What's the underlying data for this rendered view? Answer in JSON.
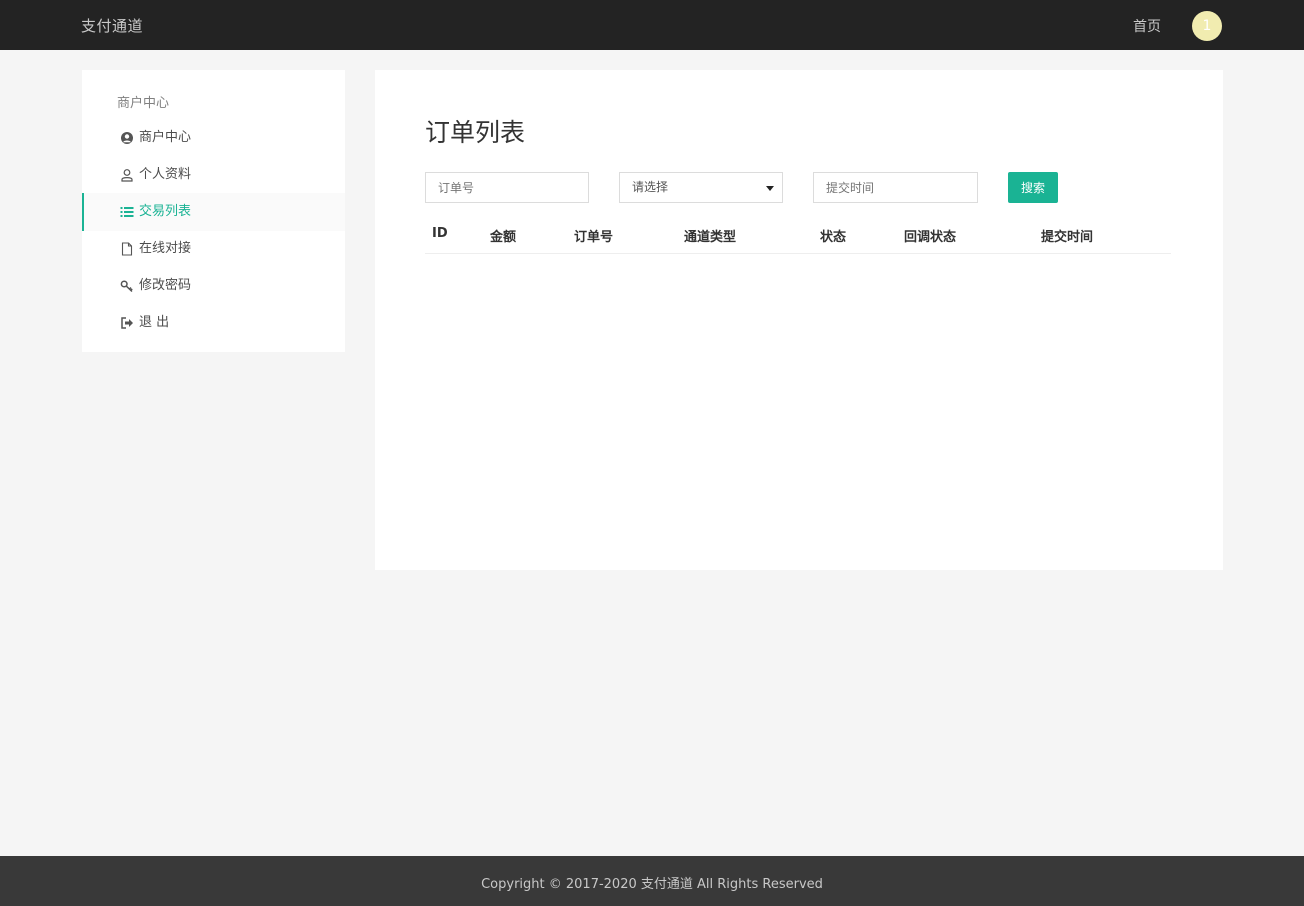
{
  "header": {
    "brand": "支付通道",
    "home_link": "首页",
    "avatar_initial": "1"
  },
  "sidebar": {
    "heading": "商户中心",
    "items": [
      {
        "label": "商户中心",
        "icon": "user-circle-icon"
      },
      {
        "label": "个人资料",
        "icon": "user-icon"
      },
      {
        "label": "交易列表",
        "icon": "list-icon",
        "active": true
      },
      {
        "label": "在线对接",
        "icon": "file-icon"
      },
      {
        "label": "修改密码",
        "icon": "key-icon"
      },
      {
        "label": "退 出",
        "icon": "logout-icon"
      }
    ]
  },
  "main": {
    "title": "订单列表",
    "filters": {
      "order_placeholder": "订单号",
      "select_value": "请选择",
      "date_placeholder": "提交时间",
      "search_label": "搜索"
    },
    "table": {
      "columns": [
        "ID",
        "金额",
        "订单号",
        "通道类型",
        "状态",
        "回调状态",
        "提交时间"
      ],
      "rows": []
    }
  },
  "footer": {
    "copyright": "Copyright © 2017-2020 支付通道 All Rights Reserved"
  },
  "colors": {
    "accent": "#1ab394",
    "topbar": "#232323",
    "footer": "#393939",
    "avatar": "#f1ecb0"
  }
}
